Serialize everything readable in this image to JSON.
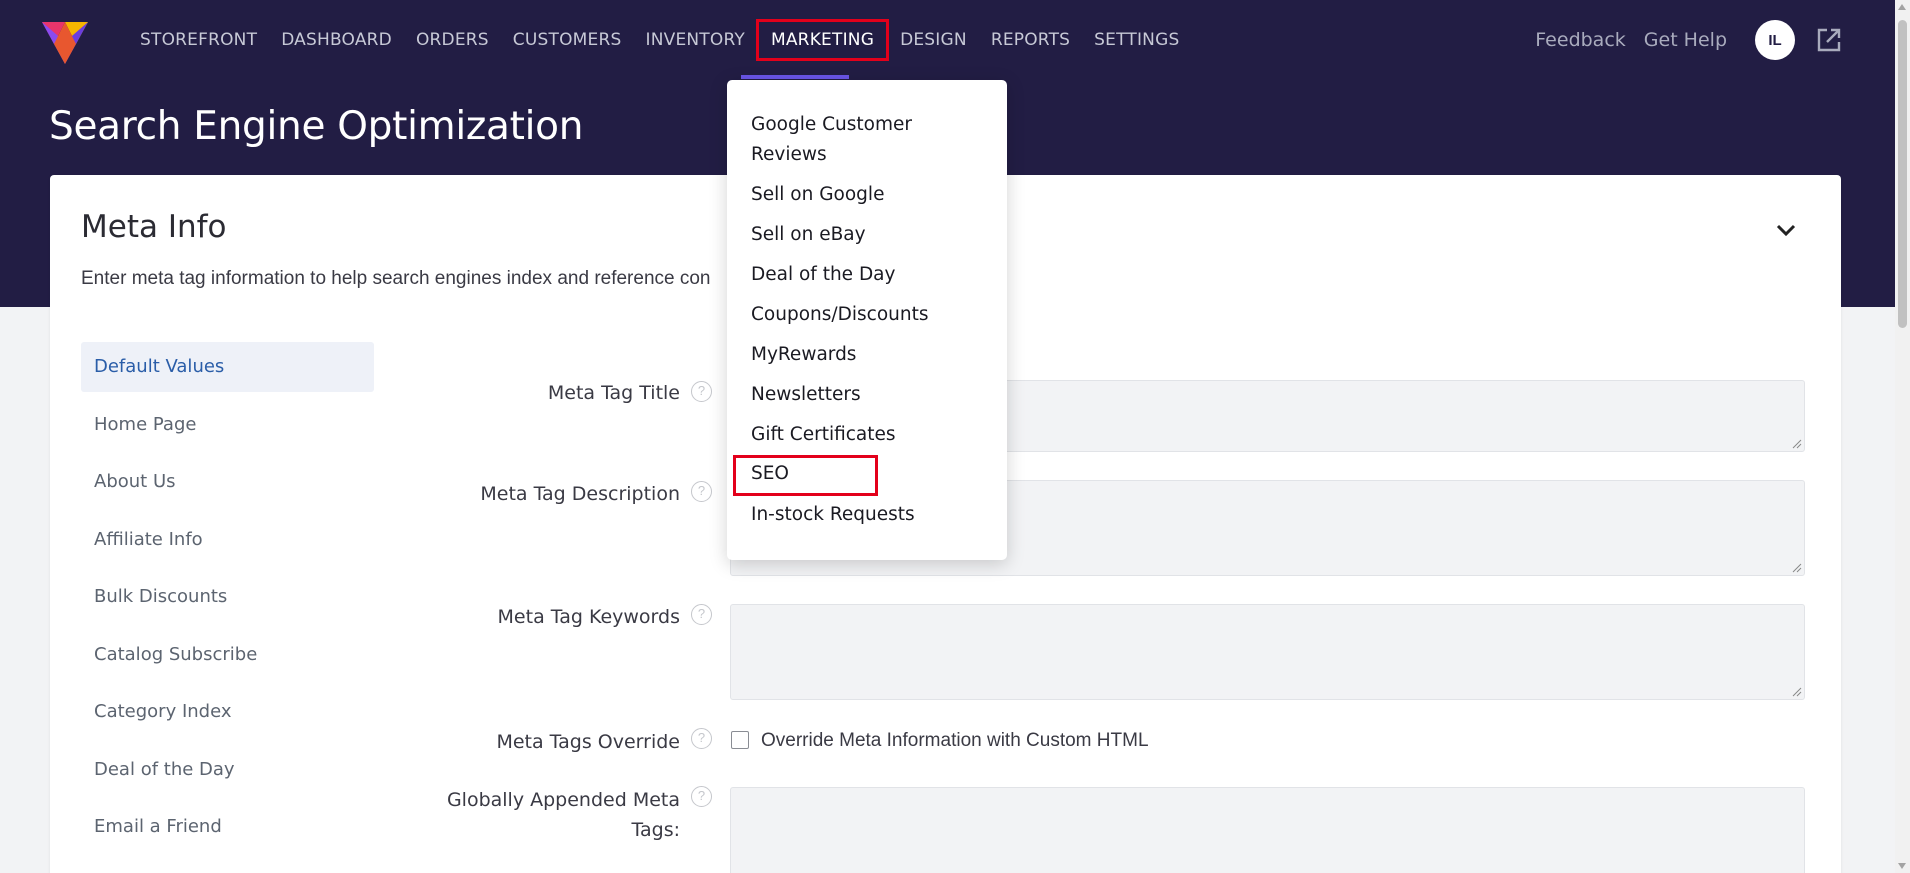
{
  "nav": {
    "items": [
      "STOREFRONT",
      "DASHBOARD",
      "ORDERS",
      "CUSTOMERS",
      "INVENTORY",
      "MARKETING",
      "DESIGN",
      "REPORTS",
      "SETTINGS"
    ],
    "active": "MARKETING",
    "feedback": "Feedback",
    "get_help": "Get Help",
    "avatar_initials": "IL"
  },
  "page": {
    "title": "Search Engine Optimization"
  },
  "card": {
    "title": "Meta Info",
    "description": "Enter meta tag information to help search engines index and reference con"
  },
  "side_tabs": [
    "Default Values",
    "Home Page",
    "About Us",
    "Affiliate Info",
    "Bulk Discounts",
    "Catalog Subscribe",
    "Category Index",
    "Deal of the Day",
    "Email a Friend"
  ],
  "form": {
    "meta_title_label": "Meta Tag Title",
    "meta_description_label": "Meta Tag Description",
    "meta_keywords_label": "Meta Tag Keywords",
    "meta_override_label": "Meta Tags Override",
    "override_checkbox_label": "Override Meta Information with Custom HTML",
    "global_meta_label_line1": "Globally Appended Meta",
    "global_meta_label_line2": "Tags:"
  },
  "marketing_menu": {
    "items": [
      "Google Customer",
      "Reviews",
      "Sell on Google",
      "Sell on eBay",
      "Deal of the Day",
      "Coupons/Discounts",
      "MyRewards",
      "Newsletters",
      "Gift Certificates",
      "SEO",
      "In-stock Requests"
    ],
    "highlighted": "SEO"
  },
  "colors": {
    "header_bg": "#221d44",
    "accent_underline": "#6a55e8",
    "highlight_border": "#e3001b",
    "active_tab_text": "#2a5da8"
  },
  "icons": [
    "logo-icon",
    "external-link-icon",
    "chevron-down-icon",
    "help-icon"
  ]
}
